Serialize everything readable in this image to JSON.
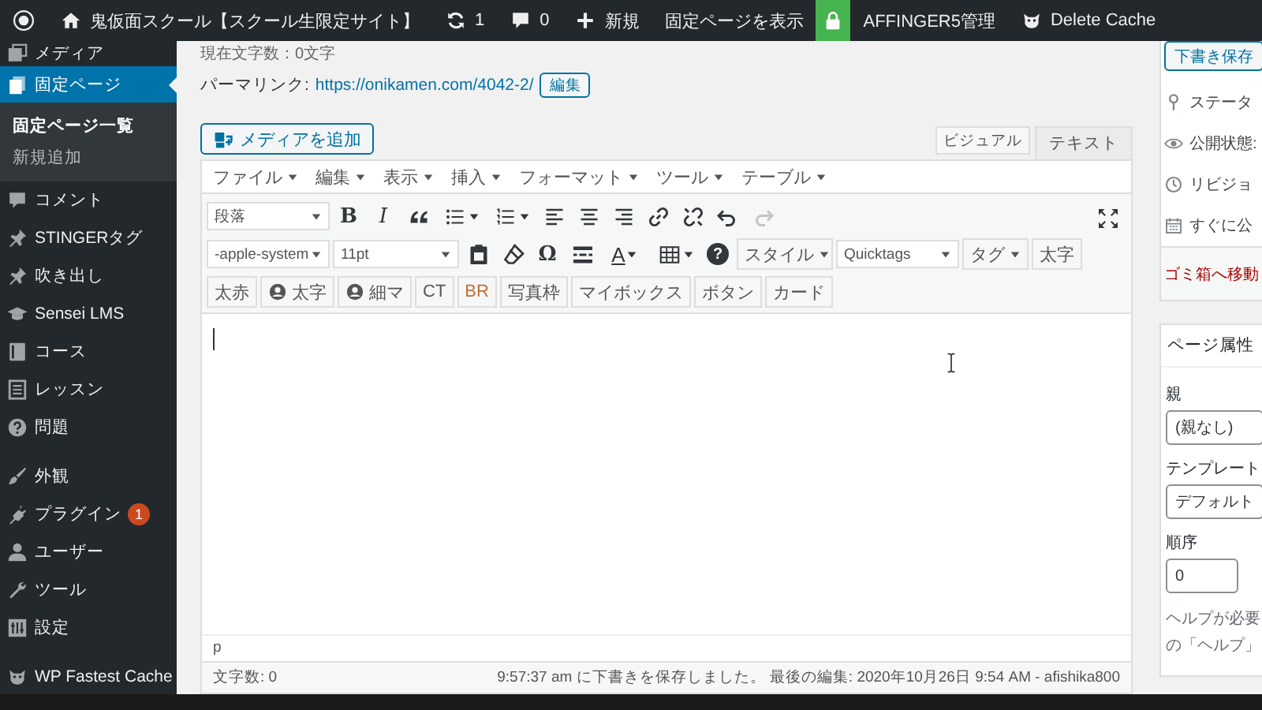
{
  "admin_bar": {
    "site_title": "鬼仮面スクール【スクール生限定サイト】",
    "updates": "1",
    "comments": "0",
    "new": "新規",
    "view_page": "固定ページを表示",
    "affinger": "AFFINGER5管理",
    "delete_cache": "Delete Cache"
  },
  "sidebar": {
    "groups": [
      {
        "items": [
          {
            "label": "メディア",
            "selected": false
          },
          {
            "label": "固定ページ",
            "selected": true,
            "children": [
              {
                "label": "固定ページ一覧",
                "selected": true
              },
              {
                "label": "新規追加",
                "selected": false
              }
            ]
          },
          {
            "label": "コメント",
            "selected": false
          },
          {
            "label": "STINGERタグ",
            "selected": false
          },
          {
            "label": "吹き出し",
            "selected": false
          },
          {
            "label": "Sensei LMS",
            "selected": false
          },
          {
            "label": "コース",
            "selected": false
          },
          {
            "label": "レッスン",
            "selected": false
          },
          {
            "label": "問題",
            "selected": false
          }
        ]
      },
      {
        "items": [
          {
            "label": "外観",
            "selected": false
          },
          {
            "label": "プラグイン",
            "selected": false,
            "badge": "1"
          },
          {
            "label": "ユーザー",
            "selected": false
          },
          {
            "label": "ツール",
            "selected": false
          },
          {
            "label": "設定",
            "selected": false
          }
        ]
      },
      {
        "items": [
          {
            "label": "WP Fastest Cache",
            "selected": false
          }
        ]
      }
    ]
  },
  "editor": {
    "char_count": "現在文字数：0文字",
    "permalink": {
      "label": "パーマリンク:",
      "url": "https://onikamen.com/4042-2/",
      "edit_button": "編集"
    },
    "add_media": "メディアを追加",
    "tabs": [
      {
        "label": "ビジュアル",
        "selected": true
      },
      {
        "label": "テキスト",
        "selected": false
      }
    ],
    "menu": [
      "ファイル",
      "編集",
      "表示",
      "挿入",
      "フォーマット",
      "ツール",
      "テーブル"
    ],
    "toolbar": {
      "format_select": "段落",
      "bold": "B",
      "italic": "I",
      "redo_disabled": true,
      "font_select": "-apple-system",
      "size_select": "11pt",
      "special_char": "Ω",
      "text_color": "A",
      "help": "?",
      "style_button": "スタイル",
      "quicktags_select": "Quicktags",
      "tag_button": "タグ",
      "bold_button": "太字",
      "quick_buttons": [
        {
          "label": "太赤",
          "kind": "plain"
        },
        {
          "label": "太字",
          "kind": "person"
        },
        {
          "label": "細マ",
          "kind": "person"
        },
        {
          "label": "CT",
          "kind": "plain"
        },
        {
          "label": "BR",
          "kind": "accent"
        },
        {
          "label": "写真枠",
          "kind": "plain"
        },
        {
          "label": "マイボックス",
          "kind": "plain"
        },
        {
          "label": "ボタン",
          "kind": "plain"
        },
        {
          "label": "カード",
          "kind": "plain"
        }
      ]
    },
    "path": "p",
    "word_count": "文字数: 0",
    "save_status": "9:57:37 am に下書きを保存しました。 最後の編集: 2020年10月26日 9:54 AM - afishika800"
  },
  "side_panel": {
    "save_draft": "下書き保存",
    "publish_rows": [
      "ステータ",
      "公開状態:",
      "リビジョ",
      "すぐに公"
    ],
    "trash": "ゴミ箱へ移動",
    "attributes": {
      "title": "ページ属性",
      "parent_label": "親",
      "parent_value": "(親なし)",
      "template_label": "テンプレート",
      "template_value": "デフォルト",
      "order_label": "順序",
      "order_value": "0",
      "help_lines": [
        "ヘルプが必要",
        "の「ヘルプ」"
      ]
    }
  }
}
